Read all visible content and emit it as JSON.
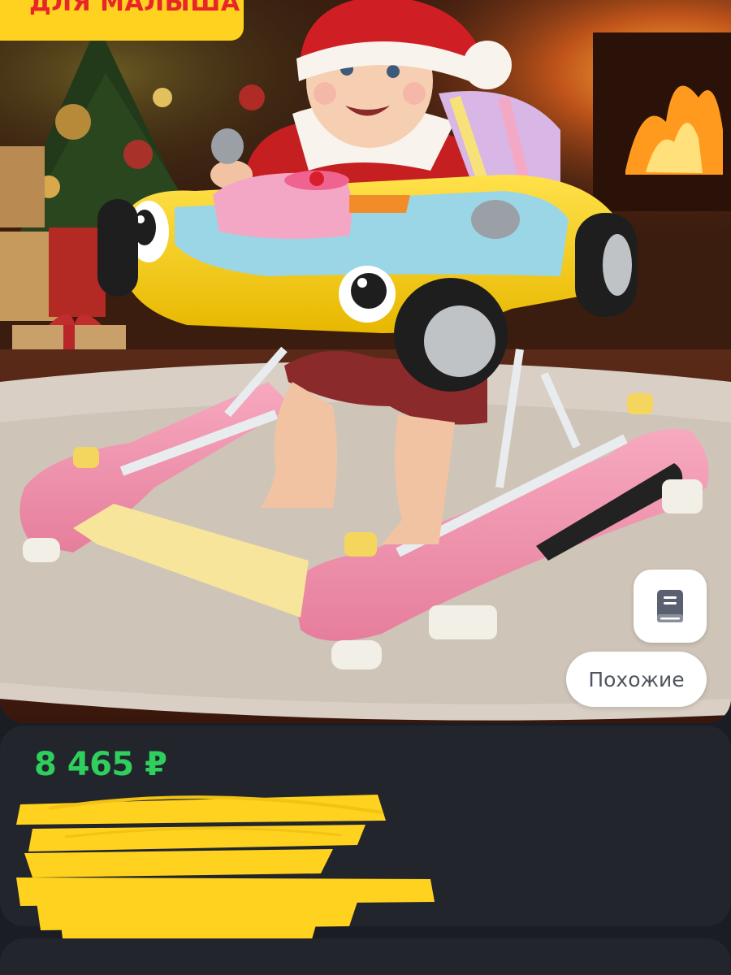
{
  "product": {
    "promo_banner_text": "ДЛЯ МАЛЫША",
    "price": "8 465 ₽",
    "price_color": "#2fcf5d"
  },
  "actions": {
    "book_icon": "book-icon",
    "similar_label": "Похожие"
  },
  "colors": {
    "background": "#1a1d24",
    "card": "#22252c",
    "banner": "#ffd21f",
    "banner_text": "#e8262a",
    "redaction": "#ffd21f"
  }
}
